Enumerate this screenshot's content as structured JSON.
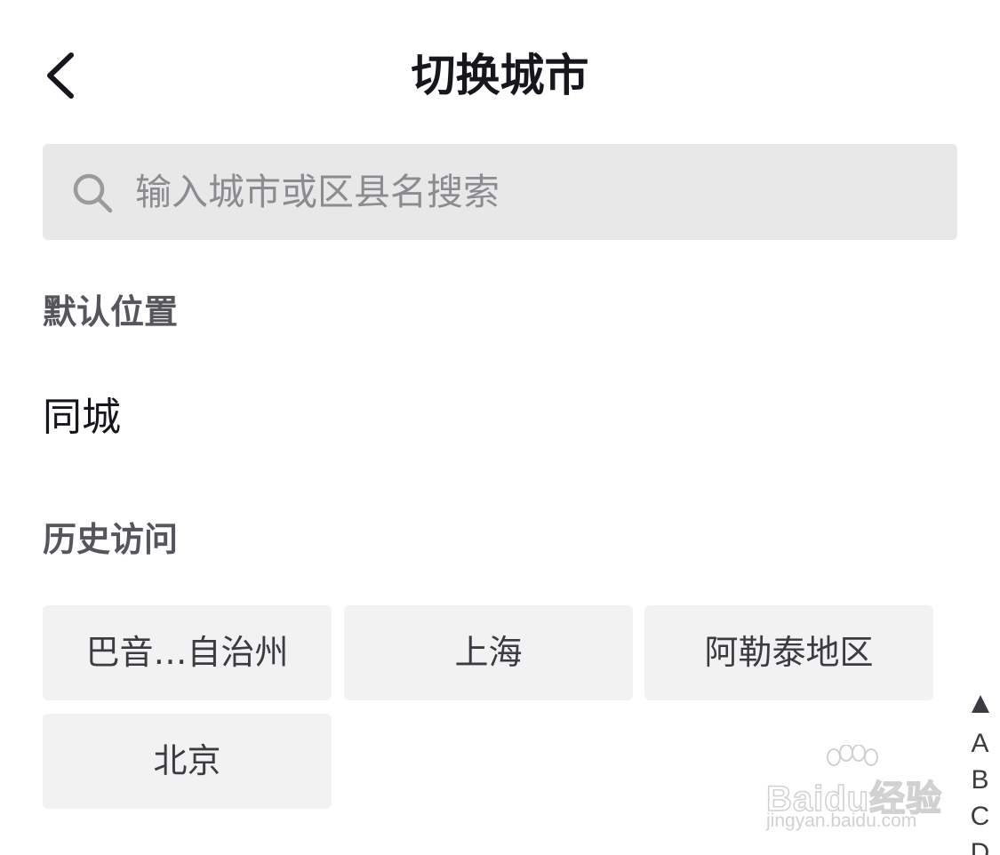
{
  "header": {
    "back_icon": "chevron-left-icon",
    "title": "切换城市"
  },
  "search": {
    "icon": "search-icon",
    "placeholder": "输入城市或区县名搜索",
    "value": ""
  },
  "default_section": {
    "label": "默认位置",
    "city": "同城"
  },
  "history_section": {
    "label": "历史访问",
    "cities": [
      "巴音…自治州",
      "上海",
      "阿勒泰地区",
      "北京"
    ]
  },
  "index_bar": {
    "top_icon": "triangle-up-icon",
    "letters": [
      "A",
      "B",
      "C",
      "D"
    ]
  },
  "watermark": {
    "logo_text": "Baidu经验",
    "url": "jingyan.baidu.com"
  },
  "colors": {
    "title": "#16161d",
    "search_bg": "#e8e8e8",
    "chip_bg": "#f2f2f3",
    "section_label": "#55555c",
    "placeholder": "#8b8b90"
  }
}
